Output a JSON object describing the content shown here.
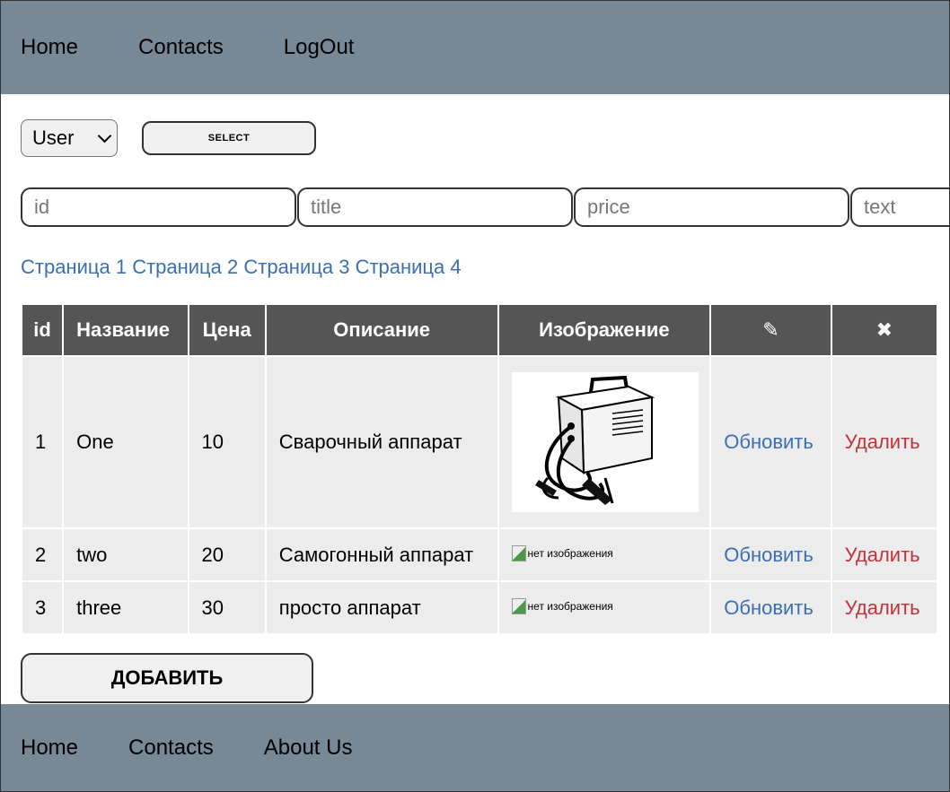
{
  "nav": {
    "home": "Home",
    "contacts": "Contacts",
    "logout": "LogOut"
  },
  "role_select": {
    "value": "User"
  },
  "select_button": "SELECT",
  "filters": {
    "id_placeholder": "id",
    "title_placeholder": "title",
    "price_placeholder": "price",
    "text_placeholder": "text"
  },
  "pages": [
    "Страница 1",
    "Страница 2",
    "Страница 3",
    "Страница 4"
  ],
  "table": {
    "headers": {
      "id": "id",
      "name": "Название",
      "price": "Цена",
      "description": "Описание",
      "image": "Изображение",
      "edit": "✎",
      "delete": "✖"
    },
    "rows": [
      {
        "id": "1",
        "name": "One",
        "price": "10",
        "description": "Сварочный аппарат",
        "image": "welding-machine",
        "update": "Обновить",
        "delete": "Удалить"
      },
      {
        "id": "2",
        "name": "two",
        "price": "20",
        "description": "Самогонный аппарат",
        "image_alt": "нет изображения",
        "update": "Обновить",
        "delete": "Удалить"
      },
      {
        "id": "3",
        "name": "three",
        "price": "30",
        "description": "просто аппарат",
        "image_alt": "нет изображения",
        "update": "Обновить",
        "delete": "Удалить"
      }
    ]
  },
  "add_button": "ДОБАВИТЬ",
  "footer": {
    "home": "Home",
    "contacts": "Contacts",
    "about": "About Us"
  },
  "colors": {
    "nav_bg": "#778896",
    "header_bg": "#555555",
    "cell_bg": "#ececec",
    "link_blue": "#3a6fb5",
    "delete_red": "#c0323a"
  }
}
